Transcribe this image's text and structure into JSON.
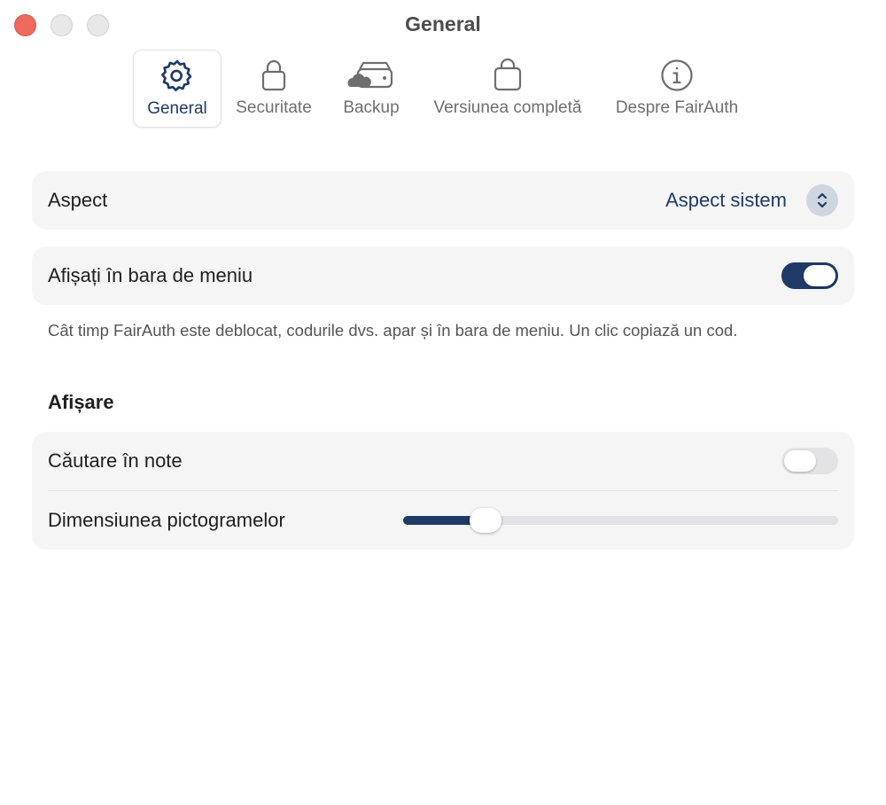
{
  "window": {
    "title": "General"
  },
  "toolbar": {
    "tabs": [
      {
        "label": "General",
        "icon": "gear-icon",
        "active": true
      },
      {
        "label": "Securitate",
        "icon": "lock-icon",
        "active": false
      },
      {
        "label": "Backup",
        "icon": "cloud-drive-icon",
        "active": false
      },
      {
        "label": "Versiunea completă",
        "icon": "shopping-bag-icon",
        "active": false
      },
      {
        "label": "Despre FairAuth",
        "icon": "info-icon",
        "active": false
      }
    ]
  },
  "settings": {
    "appearance": {
      "label": "Aspect",
      "value": "Aspect sistem"
    },
    "menu_bar": {
      "label": "Afișați în bara de meniu",
      "enabled": true,
      "note": "Cât timp FairAuth este deblocat, codurile dvs. apar și în bara de meniu. Un clic copiază un cod."
    }
  },
  "display": {
    "heading": "Afișare",
    "search_notes": {
      "label": "Căutare în note",
      "enabled": false
    },
    "icon_size": {
      "label": "Dimensiunea pictogramelor",
      "value": 0.19
    }
  },
  "colors": {
    "accent": "#1f3a66",
    "close_button": "#ee6a5f"
  }
}
